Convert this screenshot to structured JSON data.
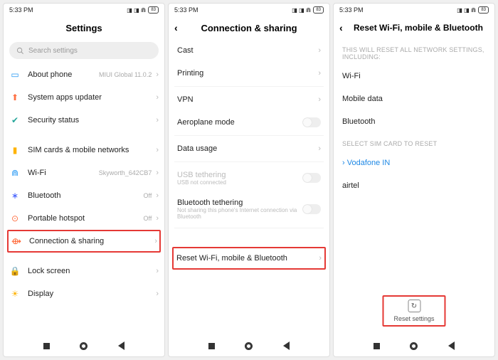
{
  "status": {
    "time": "5:33 PM",
    "battery": "83"
  },
  "screen1": {
    "title": "Settings",
    "search_placeholder": "Search settings",
    "group1": [
      {
        "icon": "phone-icon",
        "color": "c-blue",
        "label": "About phone",
        "sub": "MIUI Global 11.0.2"
      },
      {
        "icon": "update-icon",
        "color": "c-orange",
        "label": "System apps updater",
        "sub": ""
      },
      {
        "icon": "shield-icon",
        "color": "c-green",
        "label": "Security status",
        "sub": ""
      }
    ],
    "group2": [
      {
        "icon": "sim-icon",
        "color": "c-yellow",
        "label": "SIM cards & mobile networks",
        "sub": ""
      },
      {
        "icon": "wifi-icon",
        "color": "c-blue",
        "label": "Wi-Fi",
        "sub": "Skyworth_642CB7"
      },
      {
        "icon": "bluetooth-icon",
        "color": "c-bt",
        "label": "Bluetooth",
        "sub": "Off"
      },
      {
        "icon": "hotspot-icon",
        "color": "c-portable",
        "label": "Portable hotspot",
        "sub": "Off"
      },
      {
        "icon": "share-icon",
        "color": "c-share",
        "label": "Connection & sharing",
        "sub": "",
        "highlight": true
      }
    ],
    "group3": [
      {
        "icon": "lock-icon",
        "color": "c-lock",
        "label": "Lock screen",
        "sub": ""
      },
      {
        "icon": "display-icon",
        "color": "c-display",
        "label": "Display",
        "sub": ""
      }
    ]
  },
  "screen2": {
    "title": "Connection & sharing",
    "rows": {
      "cast": "Cast",
      "printing": "Printing",
      "vpn": "VPN",
      "aeroplane": "Aeroplane mode",
      "data_usage": "Data usage",
      "usb_tether": "USB tethering",
      "usb_tether_sub": "USB not connected",
      "bt_tether": "Bluetooth tethering",
      "bt_tether_sub": "Not sharing this phone's Internet connection via Bluetooth",
      "reset": "Reset Wi-Fi, mobile & Bluetooth"
    }
  },
  "screen3": {
    "title": "Reset Wi-Fi, mobile & Bluetooth",
    "section1_head": "THIS WILL RESET ALL NETWORK SETTINGS, INCLUDING:",
    "items1": [
      "Wi-Fi",
      "Mobile data",
      "Bluetooth"
    ],
    "section2_head": "SELECT SIM CARD TO RESET",
    "items2": [
      {
        "label": "Vodafone IN",
        "selected": true
      },
      {
        "label": "airtel",
        "selected": false
      }
    ],
    "reset_button": "Reset settings"
  }
}
